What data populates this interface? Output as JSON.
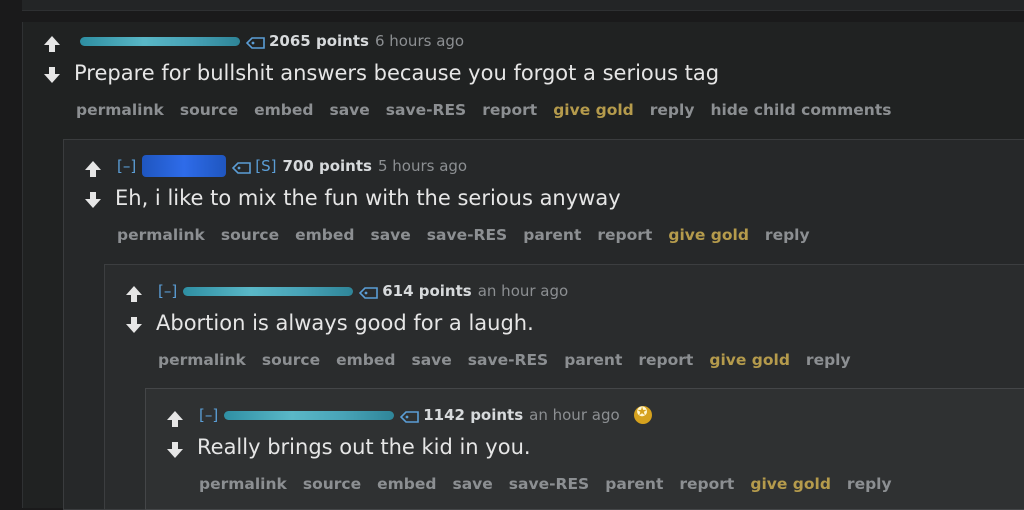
{
  "comments": [
    {
      "points": "2065 points",
      "time": "6 hours ago",
      "body": "Prepare for bullshit answers because you forgot a serious tag",
      "buttons": [
        "permalink",
        "source",
        "embed",
        "save",
        "save-RES",
        "report",
        "give gold",
        "reply",
        "hide child comments"
      ]
    },
    {
      "collapse": "[–]",
      "flair": "[S]",
      "points": "700 points",
      "time": "5 hours ago",
      "body": "Eh, i like to mix the fun with the serious anyway",
      "buttons": [
        "permalink",
        "source",
        "embed",
        "save",
        "save-RES",
        "parent",
        "report",
        "give gold",
        "reply"
      ]
    },
    {
      "collapse": "[–]",
      "points": "614 points",
      "time": "an hour ago",
      "body": "Abortion is always good for a laugh.",
      "buttons": [
        "permalink",
        "source",
        "embed",
        "save",
        "save-RES",
        "parent",
        "report",
        "give gold",
        "reply"
      ]
    },
    {
      "collapse": "[–]",
      "points": "1142 points",
      "time": "an hour ago",
      "body": "Really brings out the kid in you.",
      "buttons": [
        "permalink",
        "source",
        "embed",
        "save",
        "save-RES",
        "parent",
        "report",
        "give gold",
        "reply"
      ]
    }
  ],
  "colors": {
    "link": "#5b9ed6",
    "gold": "#b59b4c",
    "text": "#e6e6e6",
    "muted": "#8c8f92"
  }
}
